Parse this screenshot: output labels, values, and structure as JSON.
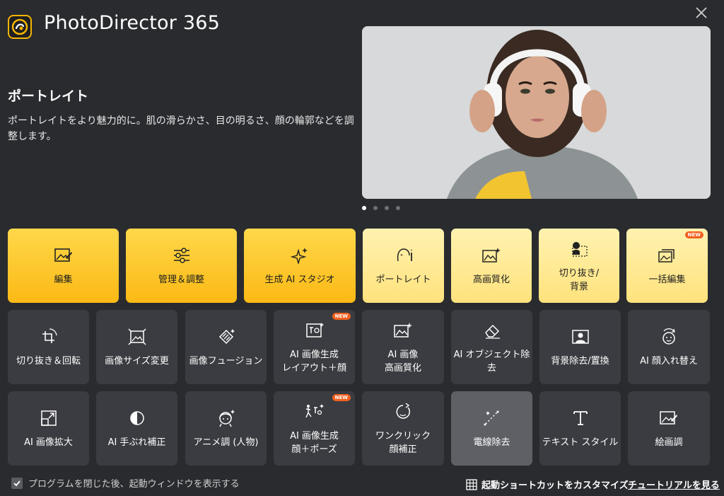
{
  "app": {
    "title": "PhotoDirector 365"
  },
  "feature": {
    "title": "ポートレイト",
    "description": "ポートレイトをより魅力的に。肌の滑らかさ、目の明るさ、顔の輪郭などを調整します。"
  },
  "carousel": {
    "count": 4,
    "active_index": 0
  },
  "tiles_row1": [
    {
      "label": "編集",
      "icon": "photo-edit-icon"
    },
    {
      "label": "管理＆調整",
      "icon": "sliders-icon"
    },
    {
      "label": "生成 AI スタジオ",
      "icon": "sparkles-icon"
    },
    {
      "label": "ポートレイト",
      "icon": "face-icon"
    },
    {
      "label": "高画質化",
      "icon": "image-enhance-icon"
    },
    {
      "label": "切り抜き/\n背景",
      "icon": "cutout-icon"
    },
    {
      "label": "一括編集",
      "icon": "batch-images-icon",
      "badge": "NEW"
    }
  ],
  "tiles_row2": [
    {
      "label": "切り抜き＆回転",
      "icon": "crop-rotate-icon"
    },
    {
      "label": "画像サイズ変更",
      "icon": "resize-icon"
    },
    {
      "label": "画像フュージョン",
      "icon": "fusion-icon"
    },
    {
      "label": "AI 画像生成\nレイアウト＋顔",
      "icon": "layout-face-icon",
      "badge": "NEW"
    },
    {
      "label": "AI 画像\n高画質化",
      "icon": "image-enhance-icon"
    },
    {
      "label": "AI オブジェクト除\n去",
      "icon": "eraser-icon"
    },
    {
      "label": "背景除去/置換",
      "icon": "background-icon"
    },
    {
      "label": "AI 顔入れ替え",
      "icon": "face-swap-icon"
    }
  ],
  "tiles_row3": [
    {
      "label": "AI 画像拡大",
      "icon": "expand-icon"
    },
    {
      "label": "AI 手ぶれ補正",
      "icon": "deblur-icon"
    },
    {
      "label": "アニメ調 (人物)",
      "icon": "anime-face-icon"
    },
    {
      "label": "AI 画像生成\n顔＋ポーズ",
      "icon": "pose-icon",
      "badge": "NEW"
    },
    {
      "label": "ワンクリック\n顔補正",
      "icon": "face-retouch-icon"
    },
    {
      "label": "電線除去",
      "icon": "wire-remove-icon"
    },
    {
      "label": "テキスト スタイル",
      "icon": "text-icon"
    },
    {
      "label": "絵画調",
      "icon": "painting-icon"
    }
  ],
  "footer": {
    "checkbox_label": "プログラムを閉じた後、起動ウィンドウを表示する",
    "checkbox_checked": true,
    "customize_label": "起動ショートカットをカスタマイズ",
    "tutorial_label": "チュートリアルを見る"
  }
}
